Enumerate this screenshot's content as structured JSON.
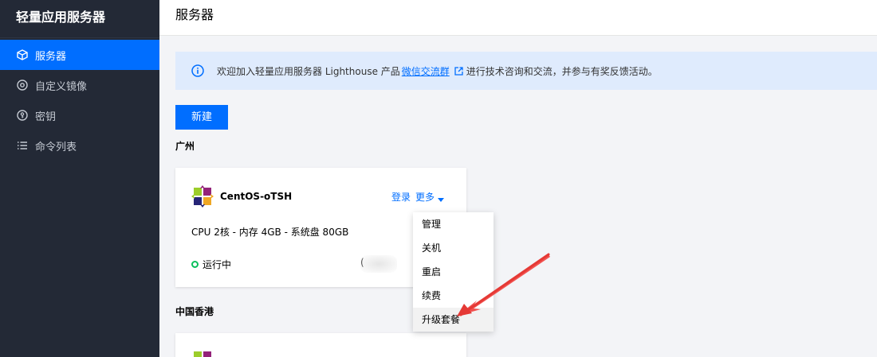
{
  "sidebar": {
    "brand": "轻量应用服务器",
    "items": [
      {
        "label": "服务器",
        "icon": "cube-icon",
        "active": true
      },
      {
        "label": "自定义镜像",
        "icon": "disc-icon",
        "active": false
      },
      {
        "label": "密钥",
        "icon": "key-icon",
        "active": false
      },
      {
        "label": "命令列表",
        "icon": "list-icon",
        "active": false
      }
    ]
  },
  "header": {
    "title": "服务器"
  },
  "notice": {
    "text_before": "欢迎加入轻量应用服务器 Lighthouse 产品",
    "link": "微信交流群",
    "text_after": "进行技术咨询和交流，并参与有奖反馈活动。"
  },
  "toolbar": {
    "new_label": "新建"
  },
  "regions": [
    {
      "name": "广州",
      "instances": [
        {
          "name": "CentOS-oTSH",
          "spec": "CPU 2核 - 内存 4GB - 系统盘 80GB",
          "status": "运行中",
          "ip_prefix": "(",
          "login_label": "登录",
          "more_label": "更多"
        }
      ]
    },
    {
      "name": "中国香港",
      "instances": []
    }
  ],
  "more_menu": {
    "items": [
      "管理",
      "关机",
      "重启",
      "续费",
      "升级套餐"
    ],
    "hovered": "升级套餐"
  },
  "colors": {
    "accent": "#006eff",
    "sidebar_bg": "#232936",
    "notice_bg": "#dfebfd",
    "status_running": "#0abf5b",
    "annotation_arrow": "#e53935"
  }
}
